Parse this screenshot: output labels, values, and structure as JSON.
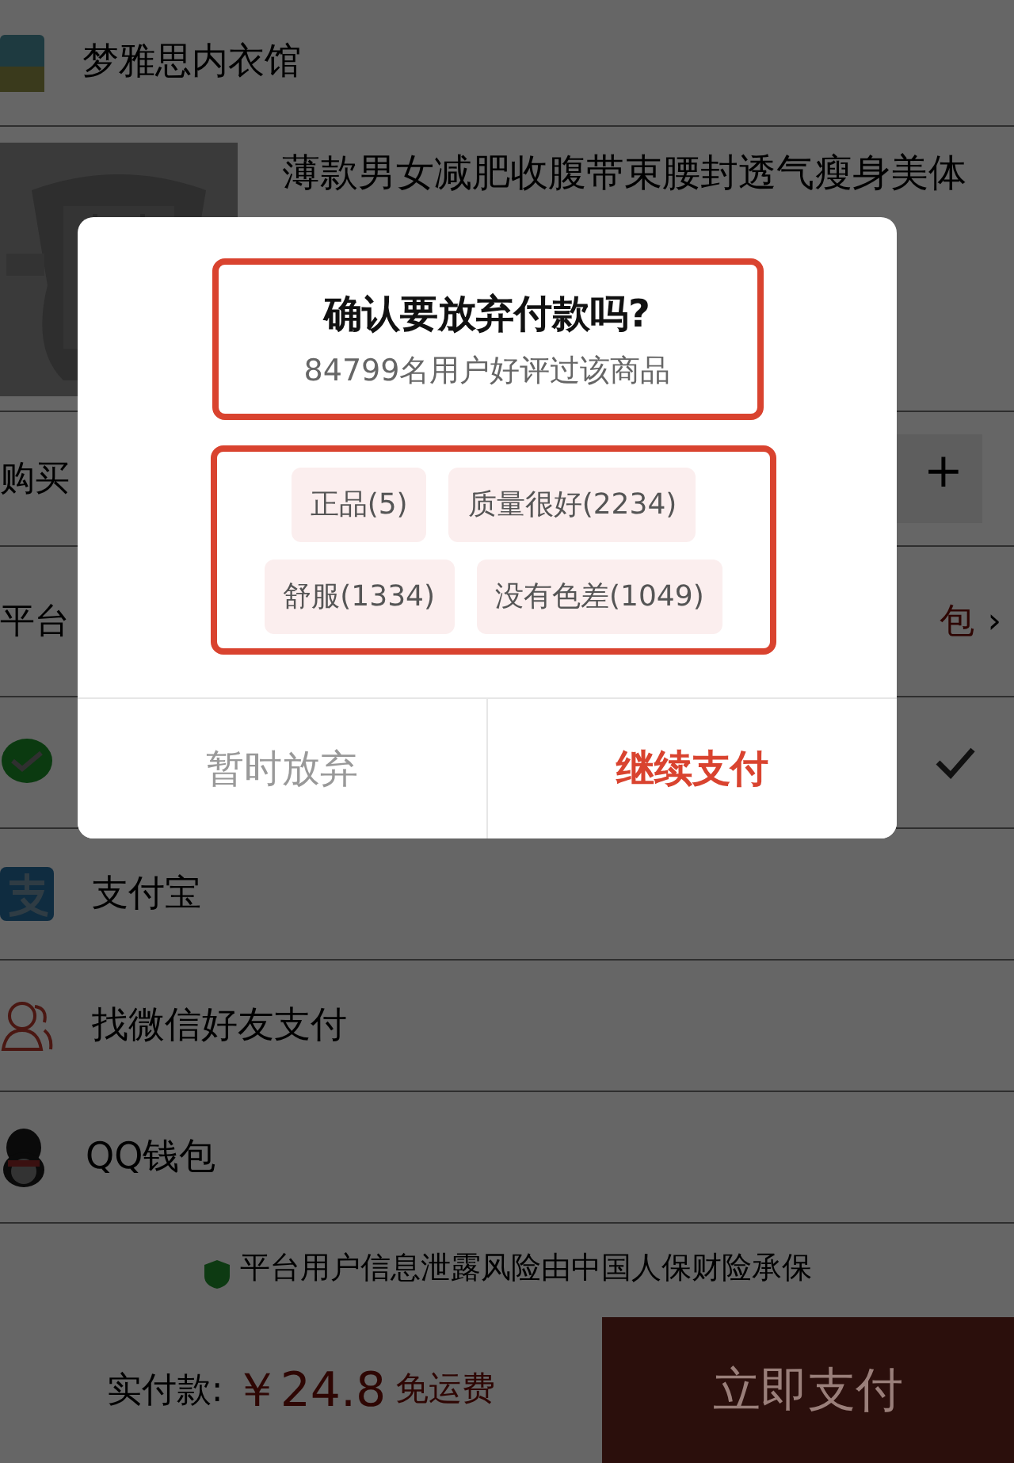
{
  "shop": {
    "name": "梦雅思内衣馆"
  },
  "product": {
    "title": "薄款男女减肥收腹带束腰封透气瘦身美体"
  },
  "quantity_row": {
    "label": "购买",
    "plus": "+"
  },
  "platform_row": {
    "label": "平台",
    "value": "包",
    "chevron": "›"
  },
  "payment_methods": [
    {
      "kind": "wechat",
      "selected": true
    },
    {
      "kind": "alipay",
      "label": "支付宝",
      "selected": false
    },
    {
      "kind": "friend",
      "label": "找微信好友支付",
      "selected": false
    },
    {
      "kind": "qq",
      "label": "QQ钱包",
      "selected": false
    }
  ],
  "notice": "平台用户信息泄露风险由中国人保财险承保",
  "footer": {
    "total_label": "实付款:",
    "amount": "￥24.8",
    "shipping": "免运费",
    "pay_button": "立即支付"
  },
  "dialog": {
    "title": "确认要放弃付款吗?",
    "subtitle": "84799名用户好评过该商品",
    "tags": [
      {
        "label": "正品(5)"
      },
      {
        "label": "质量很好(2234)"
      },
      {
        "label": "舒服(1334)"
      },
      {
        "label": "没有色差(1049)"
      }
    ],
    "cancel_button": "暂时放弃",
    "confirm_button": "继续支付"
  }
}
